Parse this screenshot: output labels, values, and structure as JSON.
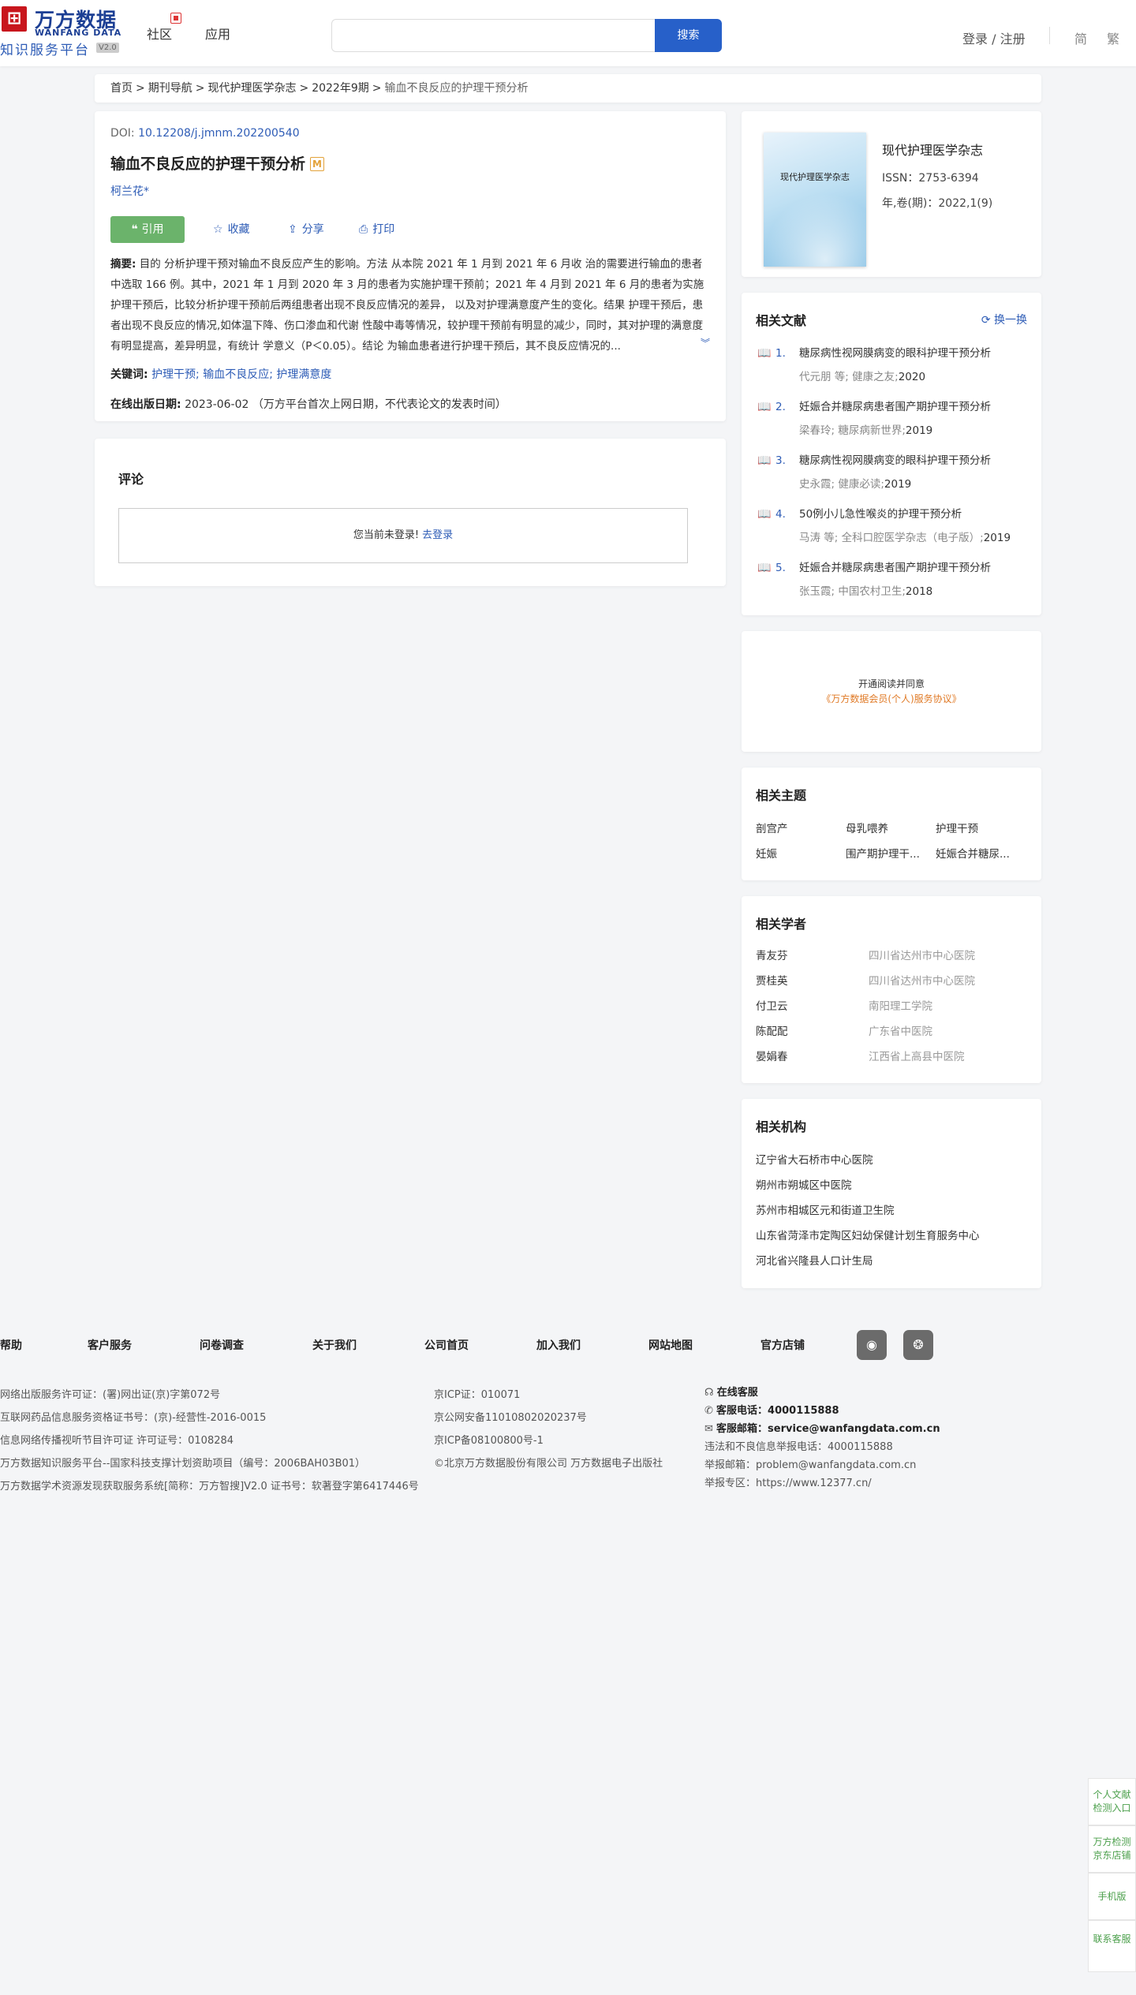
{
  "header": {
    "logo_cn": "万方数据",
    "logo_en": "WANFANG DATA",
    "logo_sub": "知识服务平台",
    "logo_version": "V2.0",
    "nav": [
      "社区",
      "应用"
    ],
    "search_placeholder": "",
    "search_button": "搜索",
    "login": "登录 / 注册",
    "lang_simplified": "简",
    "lang_traditional": "繁"
  },
  "breadcrumb": [
    "首页",
    "期刊导航",
    "现代护理医学杂志",
    "2022年9期",
    "输血不良反应的护理干预分析"
  ],
  "article": {
    "doi_label": "DOI:",
    "doi": "10.12208/j.jmnm.202200540",
    "title": "输血不良反应的护理干预分析",
    "badge": "M",
    "author": "柯兰花*",
    "actions": {
      "cite": "引用",
      "favorite": "收藏",
      "share": "分享",
      "print": "打印"
    },
    "abstract_label": "摘要:",
    "abstract": "目的 分析护理干预对输血不良反应产生的影响。方法 从本院 2021 年 1 月到 2021 年 6 月收 治的需要进行输血的患者中选取 166 例。其中，2021 年 1 月到 2020 年 3 月的患者为实施护理干预前；2021 年 4 月到 2021 年 6 月的患者为实施护理干预后，比较分析护理干预前后两组患者出现不良反应情况的差异， 以及对护理满意度产生的变化。结果 护理干预后，患者出现不良反应的情况,如体温下降、伤口渗血和代谢 性酸中毒等情况，较护理干预前有明显的减少，同时，其对护理的满意度有明显提高，差异明显，有统计 学意义（P＜0.05）。结论 为输血患者进行护理干预后，其不良反应情况的...",
    "keywords_label": "关键词:",
    "keywords": [
      "护理干预;",
      "输血不良反应;",
      "护理满意度"
    ],
    "online_date_label": "在线出版日期:",
    "online_date": "2023-06-02",
    "online_date_note": "（万方平台首次上网日期，不代表论文的发表时间）"
  },
  "comments": {
    "title": "评论",
    "not_logged_in": "您当前未登录!",
    "login_link": "去登录"
  },
  "journal": {
    "name": "现代护理医学杂志",
    "cover_text": "现代护理医学杂志",
    "issn": "ISSN：2753-6394",
    "volume": "年,卷(期)：2022,1(9)"
  },
  "related_docs": {
    "title": "相关文献",
    "swap": "换一换",
    "items": [
      {
        "num": "1.",
        "title": "糖尿病性视网膜病变的眼科护理干预分析",
        "authors": "代元朋  等; 健康之友;",
        "year": "2020"
      },
      {
        "num": "2.",
        "title": "妊娠合并糖尿病患者围产期护理干预分析",
        "authors": "梁春玲; 糖尿病新世界;",
        "year": "2019"
      },
      {
        "num": "3.",
        "title": "糖尿病性视网膜病变的眼科护理干预分析",
        "authors": "史永霞; 健康必读;",
        "year": "2019"
      },
      {
        "num": "4.",
        "title": "50例小儿急性喉炎的护理干预分析",
        "authors": "马涛  等; 全科口腔医学杂志（电子版）;",
        "year": "2019"
      },
      {
        "num": "5.",
        "title": "妊娠合并糖尿病患者围产期护理干预分析",
        "authors": "张玉霞; 中国农村卫生;",
        "year": "2018"
      }
    ]
  },
  "open_read": {
    "line1": "开通阅读并同意",
    "line2": "《万方数据会员(个人)服务协议》"
  },
  "topics": {
    "title": "相关主题",
    "items": [
      "剖宫产",
      "母乳喂养",
      "护理干预",
      "妊娠",
      "围产期护理干...",
      "妊娠合并糖尿..."
    ]
  },
  "scholars": {
    "title": "相关学者",
    "items": [
      {
        "name": "青友芬",
        "org": "四川省达州市中心医院"
      },
      {
        "name": "贾桂英",
        "org": "四川省达州市中心医院"
      },
      {
        "name": "付卫云",
        "org": "南阳理工学院"
      },
      {
        "name": "陈配配",
        "org": "广东省中医院"
      },
      {
        "name": "晏娟春",
        "org": "江西省上高县中医院"
      }
    ]
  },
  "institutions": {
    "title": "相关机构",
    "items": [
      "辽宁省大石桥市中心医院",
      "朔州市朔城区中医院",
      "苏州市相城区元和街道卫生院",
      "山东省菏泽市定陶区妇幼保健计划生育服务中心",
      "河北省兴隆县人口计生局"
    ]
  },
  "footer": {
    "links": [
      "帮助",
      "客户服务",
      "问卷调查",
      "关于我们",
      "公司首页",
      "加入我们",
      "网站地图",
      "官方店铺"
    ],
    "col1": [
      "网络出版服务许可证：(署)网出证(京)字第072号",
      "互联网药品信息服务资格证书号：(京)-经营性-2016-0015",
      "信息网络传播视听节目许可证 许可证号：0108284",
      "万方数据知识服务平台--国家科技支撑计划资助项目（编号：2006BAH03B01）",
      "万方数据学术资源发现获取服务系统[简称：万方智搜]V2.0 证书号：软著登字第6417446号"
    ],
    "col2": [
      "京ICP证：010071",
      "京公网安备11010802020237号",
      "京ICP备08100800号-1",
      "©北京万方数据股份有限公司 万方数据电子出版社"
    ],
    "online_service": "在线客服",
    "phone_label": "客服电话：",
    "phone": "4000115888",
    "email_label": "客服邮箱：",
    "email": "service@wanfangdata.com.cn",
    "report1": "违法和不良信息举报电话：4000115888",
    "report2": "举报邮箱：problem@wanfangdata.com.cn",
    "report3": "举报专区：https://www.12377.cn/"
  },
  "floating": [
    "个人文献检测入口",
    "万方检测京东店铺",
    "手机版",
    "联系客服"
  ]
}
